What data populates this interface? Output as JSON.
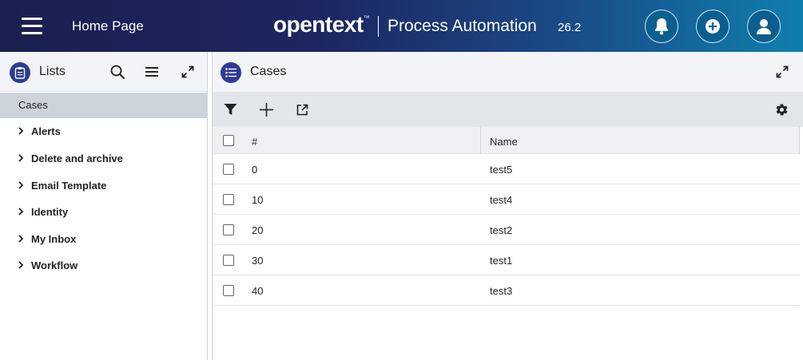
{
  "header": {
    "home_title": "Home Page",
    "brand": "opentext",
    "brand_tm": "™",
    "product": "Process Automation",
    "version": "26.2",
    "icons": [
      "menu-icon",
      "bell-icon",
      "plus-circle-icon",
      "user-icon"
    ]
  },
  "lists_panel": {
    "title": "Lists",
    "selected_item": "Cases",
    "items": [
      {
        "label": "Alerts"
      },
      {
        "label": "Delete and archive"
      },
      {
        "label": "Email Template"
      },
      {
        "label": "Identity"
      },
      {
        "label": "My Inbox"
      },
      {
        "label": "Workflow"
      }
    ]
  },
  "cases_panel": {
    "title": "Cases",
    "columns": {
      "num": "#",
      "name": "Name"
    },
    "rows": [
      {
        "num": "0",
        "name": "test5"
      },
      {
        "num": "10",
        "name": "test4"
      },
      {
        "num": "20",
        "name": "test2"
      },
      {
        "num": "30",
        "name": "test1"
      },
      {
        "num": "40",
        "name": "test3"
      }
    ]
  },
  "colors": {
    "accent": "#2e3b93",
    "header_start": "#1b1f4f",
    "header_end": "#0f7fae",
    "selected_bg": "#cdd3da"
  }
}
